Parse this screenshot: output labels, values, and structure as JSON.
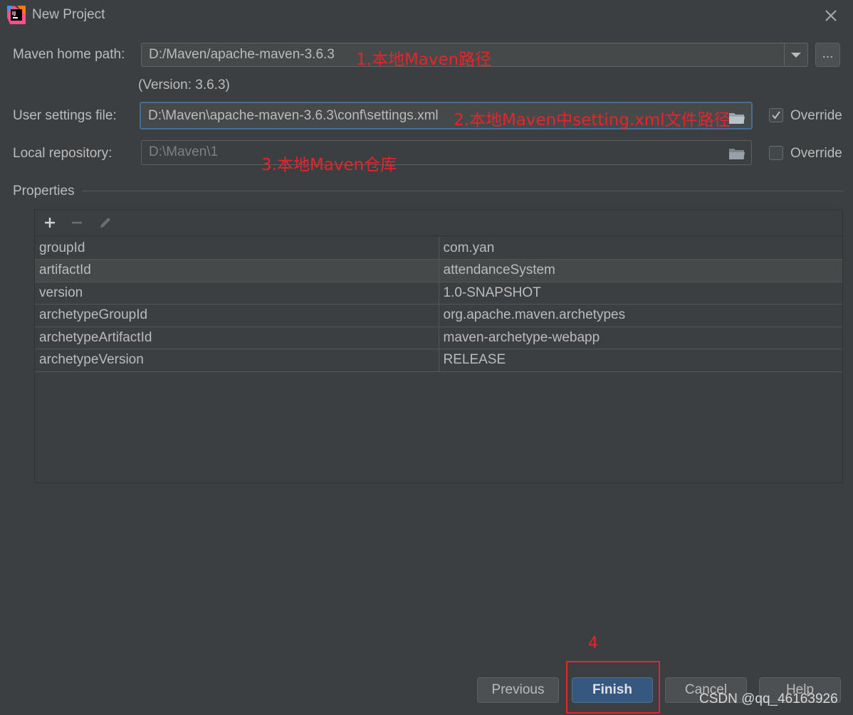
{
  "window": {
    "title": "New Project"
  },
  "maven_home": {
    "label": "Maven home path:",
    "value": "D:/Maven/apache-maven-3.6.3",
    "annotation": "1.本地Maven路径",
    "browse_label": "..."
  },
  "version_text": "(Version: 3.6.3)",
  "user_settings": {
    "label": "User settings file:",
    "value": "D:\\Maven\\apache-maven-3.6.3\\conf\\settings.xml",
    "annotation": "2.本地Maven中setting.xml文件路径",
    "override_label": "Override",
    "override_checked": true
  },
  "local_repo": {
    "label": "Local repository:",
    "value": "D:\\Maven\\1",
    "annotation": "3.本地Maven仓库",
    "override_label": "Override",
    "override_checked": false
  },
  "properties": {
    "header": "Properties",
    "toolbar": [
      "add-icon",
      "remove-icon",
      "edit-icon"
    ],
    "rows": [
      {
        "key": "groupId",
        "value": "com.yan"
      },
      {
        "key": "artifactId",
        "value": "attendanceSystem"
      },
      {
        "key": "version",
        "value": "1.0-SNAPSHOT"
      },
      {
        "key": "archetypeGroupId",
        "value": "org.apache.maven.archetypes"
      },
      {
        "key": "archetypeArtifactId",
        "value": "maven-archetype-webapp"
      },
      {
        "key": "archetypeVersion",
        "value": "RELEASE"
      }
    ],
    "selected_row": 1
  },
  "footer": {
    "step_annotation": "4",
    "previous_label": "Previous",
    "finish_label": "Finish",
    "cancel_label": "Cancel",
    "help_label": "Help"
  },
  "watermark": "CSDN @qq_46163926",
  "colors": {
    "background": "#3c3f41",
    "annotation_red": "#e8242a",
    "primary_button": "#365880",
    "focus_border": "#466d94"
  }
}
